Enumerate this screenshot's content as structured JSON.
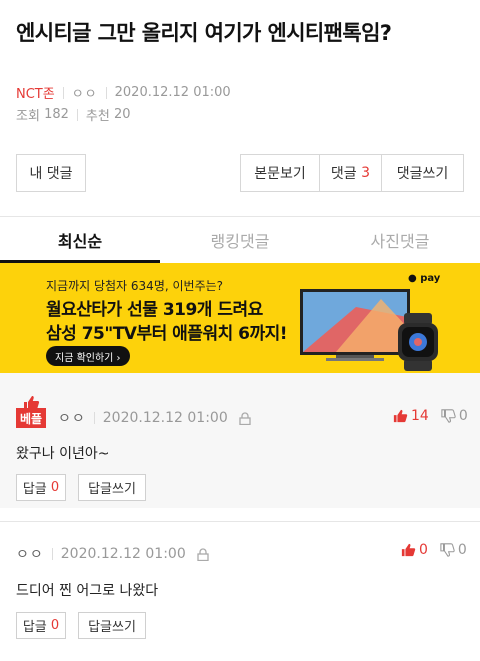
{
  "post": {
    "title": "엔시티글 그만 올리지 여기가 엔시티팬톡임?",
    "category": "NCT존",
    "author": "ㅇㅇ",
    "datetime": "2020.12.12 01:00",
    "views_label": "조회",
    "views": "182",
    "recommend_label": "추천",
    "recommend": "20"
  },
  "actions": {
    "my_comments": "내 댓글",
    "view_post": "본문보기",
    "comments_label": "댓글",
    "comments_count": "3",
    "write_comment": "댓글쓰기"
  },
  "tabs": [
    {
      "label": "최신순",
      "active": true
    },
    {
      "label": "랭킹댓글",
      "active": false
    },
    {
      "label": "사진댓글",
      "active": false
    }
  ],
  "banner": {
    "line1": "지금까지 당첨자 634명, 이번주는?",
    "line2": "월요산타가 선물 319개 드려요",
    "line3": "삼성 75\"TV부터 애플워치 6까지!",
    "cta": "지금 확인하기 ›",
    "pay": "● pay",
    "bg_color": "#fdd20b"
  },
  "comments": [
    {
      "best_label": "베플",
      "author": "ㅇㅇ",
      "datetime": "2020.12.12 01:00",
      "text": "왔구나 이년아~",
      "up": "14",
      "down": "0",
      "reply_label": "답글",
      "reply_count": "0",
      "write_reply": "답글쓰기"
    },
    {
      "author": "ㅇㅇ",
      "datetime": "2020.12.12 01:00",
      "text": "드디어 찐 어그로 나왔다",
      "up": "0",
      "down": "0",
      "reply_label": "답글",
      "reply_count": "0",
      "write_reply": "답글쓰기"
    }
  ],
  "colors": {
    "accent": "#e53935",
    "muted": "#999999"
  }
}
